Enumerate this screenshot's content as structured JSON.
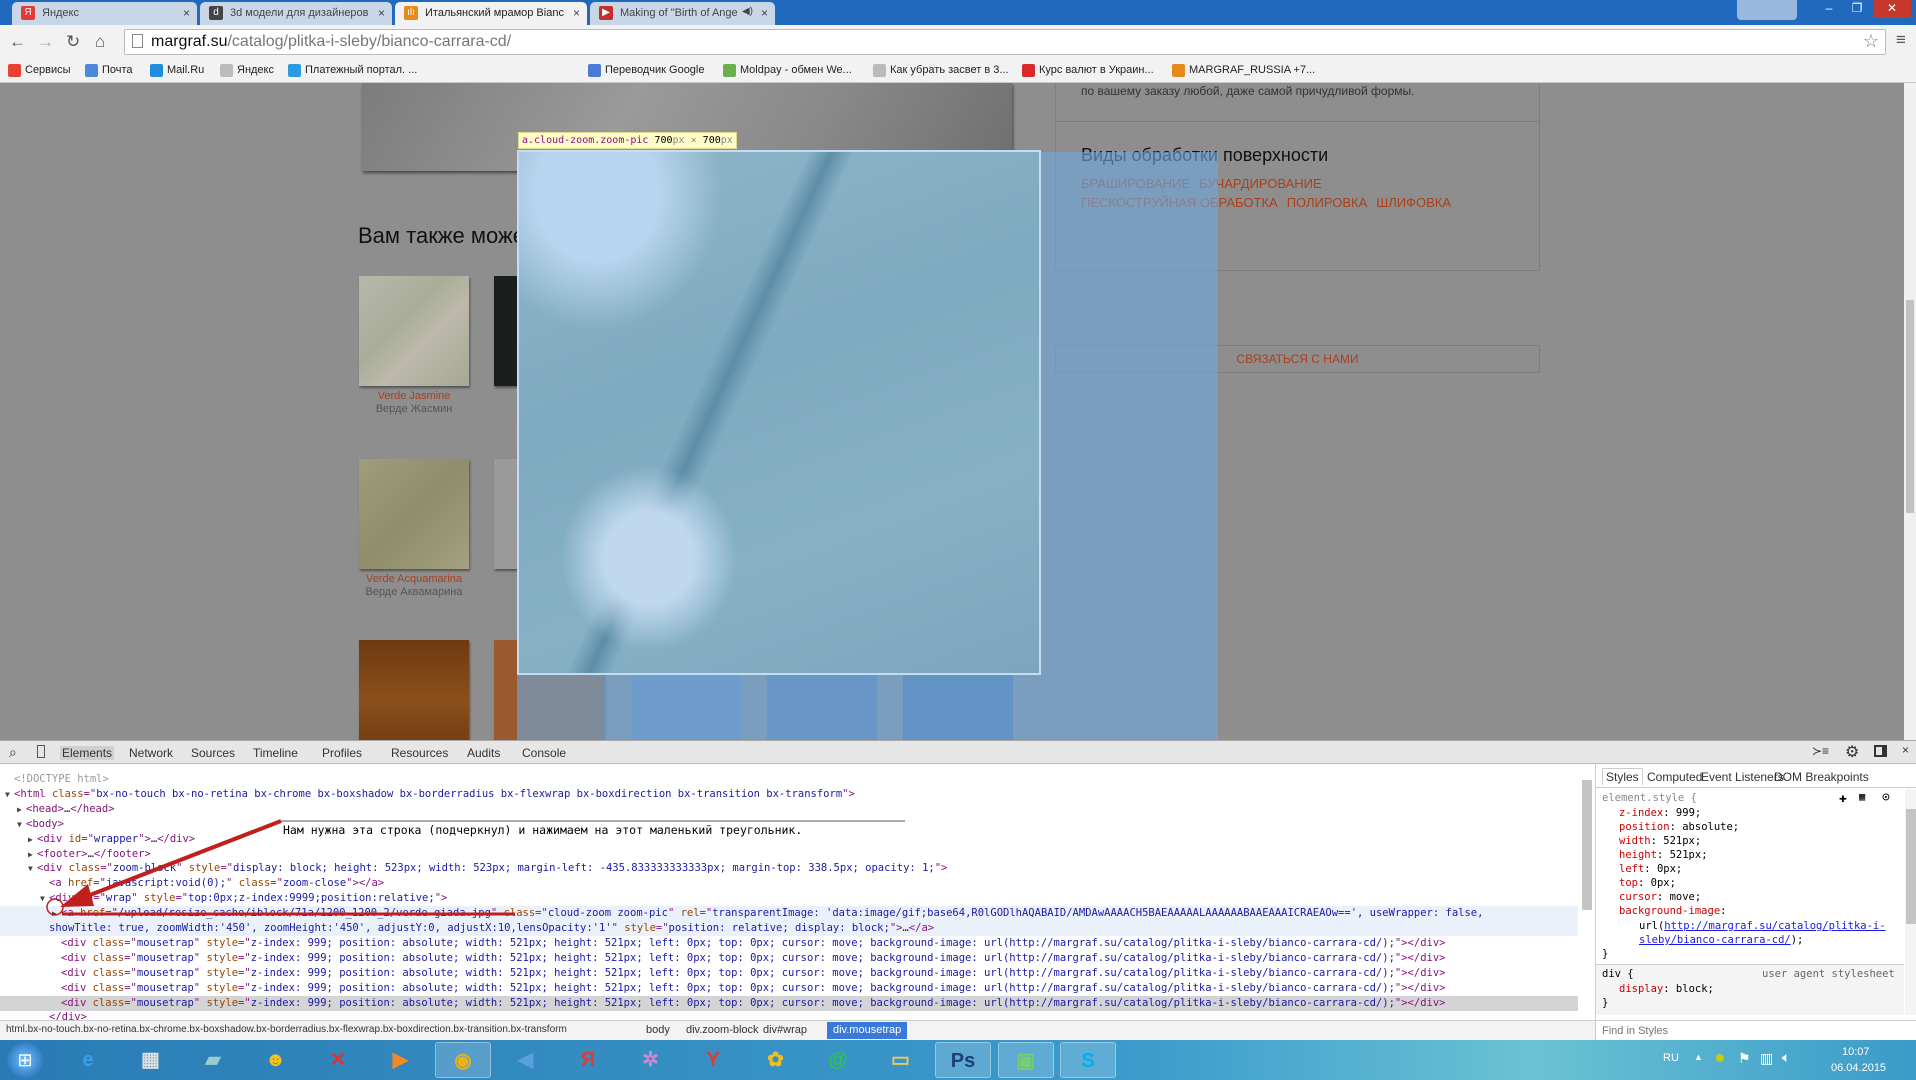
{
  "browser": {
    "tabs": [
      {
        "label": "Яндекс",
        "icon": "yandex-icon",
        "color": "#e53935",
        "glyph": "Я"
      },
      {
        "label": "3d модели для дизайнеров",
        "icon": "3d-models-icon",
        "color": "#444",
        "glyph": "d"
      },
      {
        "label": "Итальянский мрамор Bianc",
        "icon": "margraf-icon",
        "color": "#e88a1a",
        "glyph": "ılı",
        "active": true
      },
      {
        "label": "Making of \"Birth of Ange",
        "icon": "youtube-icon",
        "color": "#c4302b",
        "glyph": "▶",
        "audio": true
      }
    ],
    "close_glyph": "×",
    "url_host": "margraf.su",
    "url_path": "/catalog/plitka-i-sleby/bianco-carrara-cd/",
    "bookmarks": [
      {
        "label": "Сервисы",
        "icon": "apps-grid-icon",
        "color": "#e94235"
      },
      {
        "label": "Почта",
        "icon": "mail-icon",
        "color": "#4a8ad9"
      },
      {
        "label": "Mail.Ru",
        "icon": "mailru-icon",
        "color": "#1f8ee0"
      },
      {
        "label": "Яндекс",
        "icon": "page-icon",
        "color": "#bbb"
      },
      {
        "label": "Платежный портал. ...",
        "icon": "payment-portal-icon",
        "color": "#2a9be0"
      },
      {
        "label": "Переводчик Google",
        "icon": "google-translate-icon",
        "color": "#4a7cd6"
      },
      {
        "label": "Moldpay - обмен We...",
        "icon": "moldpay-icon",
        "color": "#6ab04c"
      },
      {
        "label": "Как убрать засвет в 3...",
        "icon": "page-icon",
        "color": "#bbb"
      },
      {
        "label": "Курс валют в Украин...",
        "icon": "currency-icon",
        "color": "#d92a2a"
      },
      {
        "label": "MARGRAF_RUSSIA +7...",
        "icon": "margraf-icon",
        "color": "#e88a1a"
      }
    ]
  },
  "page": {
    "intro_text": "по вашему заказу любой, даже самой причудливой формы.",
    "related_title": "Вам также може",
    "products": [
      {
        "name_en": "Verde Jasmine",
        "name_ru": "Верде Жасмин"
      },
      {
        "name_en": "Verde Acquamarina",
        "name_ru": "Верде Аквамарина"
      }
    ],
    "surface_title": "Виды обработки поверхности",
    "surface_links_row1": [
      "БРАШИРОВАНИЕ",
      "БУЧАРДИРОВАНИЕ"
    ],
    "surface_links_row2": [
      "ПЕСКОСТРУЙНАЯ ОБРАБОТКА",
      "ПОЛИРОВКА",
      "ШЛИФОВКА"
    ],
    "contact_button": "СВЯЗАТЬСЯ С НАМИ",
    "inspect_tooltip": {
      "selector": "a.cloud-zoom.zoom-pic",
      "w": "700",
      "h": "700",
      "unit": "px",
      "times": "×"
    },
    "accent_color": "#a8401e"
  },
  "devtools": {
    "tabs": [
      "Elements",
      "Network",
      "Sources",
      "Timeline",
      "Profiles",
      "Resources",
      "Audits",
      "Console"
    ],
    "active_tab": "Elements",
    "annotation": "Нам нужна эта строка (подчеркнул) и нажимаем на этот маленький треугольник.",
    "lines": [
      {
        "indent": 0,
        "arrow": "",
        "dim": true,
        "text": "<!DOCTYPE html>"
      },
      {
        "indent": 0,
        "arrow": "down",
        "text": "<html class=\"bx-no-touch bx-no-retina bx-chrome bx-boxshadow bx-borderradius bx-flexwrap bx-boxdirection bx-transition bx-transform\">"
      },
      {
        "indent": 1,
        "arrow": "right",
        "text": "<head>…</head>"
      },
      {
        "indent": 1,
        "arrow": "down",
        "text": "<body>"
      },
      {
        "indent": 2,
        "arrow": "right",
        "text": "<div id=\"wrapper\">…</div>"
      },
      {
        "indent": 2,
        "arrow": "right",
        "text": "<footer>…</footer>"
      },
      {
        "indent": 2,
        "arrow": "down",
        "text": "<div class=\"zoom-block\" style=\"display: block; height: 523px; width: 523px; margin-left: -435.833333333333px; margin-top: 338.5px; opacity: 1;\">"
      },
      {
        "indent": 3,
        "arrow": "",
        "text": "<a href=\"javascript:void(0);\" class=\"zoom-close\"></a>"
      },
      {
        "indent": 3,
        "arrow": "down",
        "text": "<div id=\"wrap\" style=\"top:0px;z-index:9999;position:relative;\">"
      },
      {
        "indent": 4,
        "arrow": "right",
        "selected": true,
        "text": "<a href=\"/upload/resize_cache/iblock/71a/1200_1200_2/verde giada.jpg\" class=\"cloud-zoom zoom-pic\" rel=\"transparentImage: 'data:image/gif;base64,R0lGODlhAQABAID/AMDAwAAAACH5BAEAAAAALAAAAAABAAEAAAICRAEAOw==', useWrapper: false,"
      },
      {
        "indent": 4,
        "arrow": "",
        "selected": true,
        "cont": true,
        "text": "showTitle: true, zoomWidth:'450', zoomHeight:'450', adjustY:0, adjustX:10,lensOpacity:'1'\" style=\"position: relative; display: block;\">…</a>"
      },
      {
        "indent": 4,
        "arrow": "",
        "text": "<div class=\"mousetrap\" style=\"z-index: 999; position: absolute; width: 521px; height: 521px; left: 0px; top: 0px; cursor: move; background-image: url(http://margraf.su/catalog/plitka-i-sleby/bianco-carrara-cd/);\"></div>"
      },
      {
        "indent": 4,
        "arrow": "",
        "text": "<div class=\"mousetrap\" style=\"z-index: 999; position: absolute; width: 521px; height: 521px; left: 0px; top: 0px; cursor: move; background-image: url(http://margraf.su/catalog/plitka-i-sleby/bianco-carrara-cd/);\"></div>"
      },
      {
        "indent": 4,
        "arrow": "",
        "text": "<div class=\"mousetrap\" style=\"z-index: 999; position: absolute; width: 521px; height: 521px; left: 0px; top: 0px; cursor: move; background-image: url(http://margraf.su/catalog/plitka-i-sleby/bianco-carrara-cd/);\"></div>"
      },
      {
        "indent": 4,
        "arrow": "",
        "text": "<div class=\"mousetrap\" style=\"z-index: 999; position: absolute; width: 521px; height: 521px; left: 0px; top: 0px; cursor: move; background-image: url(http://margraf.su/catalog/plitka-i-sleby/bianco-carrara-cd/);\"></div>"
      },
      {
        "indent": 4,
        "arrow": "",
        "hover": true,
        "text": "<div class=\"mousetrap\" style=\"z-index: 999; position: absolute; width: 521px; height: 521px; left: 0px; top: 0px; cursor: move; background-image: url(http://margraf.su/catalog/plitka-i-sleby/bianco-carrara-cd/);\"></div>"
      },
      {
        "indent": 3,
        "arrow": "",
        "text": "</div>"
      }
    ],
    "styles_tabs": [
      "Styles",
      "Computed",
      "Event Listeners",
      "DOM Breakpoints"
    ],
    "element_style_selector": "element.style {",
    "element_style": [
      {
        "name": "z-index",
        "value": "999;"
      },
      {
        "name": "position",
        "value": "absolute;"
      },
      {
        "name": "width",
        "value": "521px;"
      },
      {
        "name": "height",
        "value": "521px;"
      },
      {
        "name": "left",
        "value": "0px;"
      },
      {
        "name": "top",
        "value": "0px;"
      },
      {
        "name": "cursor",
        "value": "move;"
      },
      {
        "name": "background-image",
        "value": ""
      }
    ],
    "bg_url_prefix": "url(",
    "bg_url_line1": "http://margraf.su/catalog/plitka-i-",
    "bg_url_line2": "sleby/bianco-carrara-cd/",
    "bg_url_suffix": ");",
    "close_brace": "}",
    "ua_selector": "div {",
    "ua_label": "user agent stylesheet",
    "ua_prop": {
      "name": "display",
      "value": "block;"
    },
    "find_placeholder": "Find in Styles",
    "breadcrumbs": [
      "html.bx-no-touch.bx-no-retina.bx-chrome.bx-boxshadow.bx-borderradius.bx-flexwrap.bx-boxdirection.bx-transition.bx-transform",
      "body",
      "div.zoom-block",
      "div#wrap",
      "div.mousetrap"
    ]
  },
  "taskbar": {
    "apps": [
      {
        "icon": "ie-icon",
        "glyph": "e",
        "color": "#3aa0e8"
      },
      {
        "icon": "calculator-icon",
        "glyph": "▦",
        "color": "#ddd"
      },
      {
        "icon": "notes-icon",
        "glyph": "▰",
        "color": "#9cc"
      },
      {
        "icon": "messenger-icon",
        "glyph": "☻",
        "color": "#f4c21a"
      },
      {
        "icon": "app-red-icon",
        "glyph": "✕",
        "color": "#d33"
      },
      {
        "icon": "media-player-icon",
        "glyph": "▶",
        "color": "#f08a24"
      },
      {
        "icon": "chrome-icon",
        "glyph": "◉",
        "color": "#e8b21a",
        "open": true
      },
      {
        "icon": "speaker-app-icon",
        "glyph": "◀",
        "color": "#5aa0e0"
      },
      {
        "icon": "yandex-browser-icon",
        "glyph": "Я",
        "color": "#e53935"
      },
      {
        "icon": "spider-icon",
        "glyph": "✲",
        "color": "#c8c"
      },
      {
        "icon": "yandex-y-icon",
        "glyph": "Y",
        "color": "#e53935"
      },
      {
        "icon": "picasa-icon",
        "glyph": "✿",
        "color": "#f0c020"
      },
      {
        "icon": "icq-icon",
        "glyph": "@",
        "color": "#2fc44a"
      },
      {
        "icon": "explorer-icon",
        "glyph": "▭",
        "color": "#f0c860"
      },
      {
        "icon": "photoshop-icon",
        "glyph": "Ps",
        "color": "#1d3f7a",
        "open": true
      },
      {
        "icon": "monitor-app-icon",
        "glyph": "▣",
        "color": "#7c7",
        "open": true
      },
      {
        "icon": "skype-icon",
        "glyph": "S",
        "color": "#00aff0",
        "open": true
      }
    ],
    "lang": "RU",
    "time": "10:07",
    "date": "06.04.2015"
  }
}
